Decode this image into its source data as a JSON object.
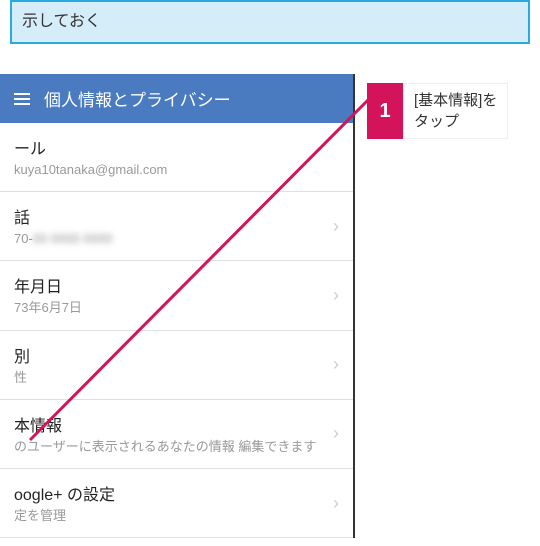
{
  "info_box": {
    "line2": "示しておく"
  },
  "header": {
    "title": "個人情報とプライバシー"
  },
  "items": {
    "email": {
      "title": "ール",
      "sub": "kuya10tanaka@gmail.com"
    },
    "phone": {
      "title": "話",
      "sub": "70-"
    },
    "birth": {
      "title": "年月日",
      "sub": "73年6月7日"
    },
    "gender": {
      "title": "別",
      "sub": "性"
    },
    "basic": {
      "title": "本情報",
      "sub": "のユーザーに表示されるあなたの情報\n編集できます"
    },
    "gplus": {
      "title": "oogle+ の設定",
      "sub": "定を管理"
    }
  },
  "callout": {
    "number": "1",
    "text": "[基本情報]を\nタップ"
  }
}
